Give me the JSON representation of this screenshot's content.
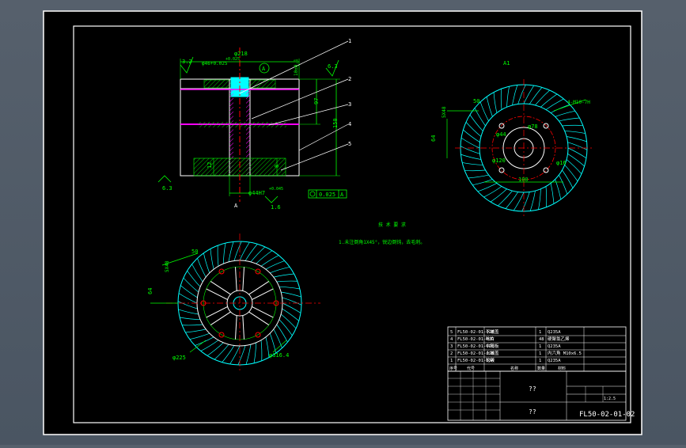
{
  "sheet": {
    "colors": {
      "background": "#000000",
      "frame": "#ffffff",
      "dimension": "#00ff00",
      "gear_teeth": "#00ffff",
      "center_line": "#ff0000",
      "hatch": "#ff00ff",
      "hidden": "#ffff00"
    }
  },
  "section_view": {
    "dims": {
      "top_dia": "φ218",
      "bore_tol": "φ46+0.025",
      "bore_zero": "0",
      "bore_sub": "+0.025",
      "roughness_top": "3.2",
      "roughness_right": "6.3",
      "roughness_bottom": "6.3",
      "datum_a": "A",
      "flatness": "10±0.1",
      "h97": "97",
      "h150": "150",
      "dim_12": "12",
      "dim_8": "8",
      "bottom_dia": "φ44H7",
      "bottom_sub": "+0.045",
      "r16": "1.6",
      "tolerance": "0.025",
      "tol_ref": "A",
      "view_label": "A"
    },
    "callouts": [
      "1",
      "2",
      "3",
      "4",
      "5"
    ]
  },
  "top_view": {
    "label": "A1",
    "dims": {
      "d50": "50",
      "d5x48": "5X48",
      "d64": "64",
      "holes": "4-M10-7H",
      "d100": "100",
      "d16": "φ16",
      "d44": "φ44",
      "d78": "φ78",
      "d120": "φ120"
    }
  },
  "bottom_view": {
    "dims": {
      "d50": "50",
      "d5x48": "5X48",
      "d64": "64",
      "d225": "φ225",
      "d3164": "φ316.4"
    }
  },
  "notes": {
    "title": "技 术 要 求",
    "line1": "1.未注倒角1X45°，锐边倒钝，去毛刺。"
  },
  "parts_list": {
    "rows": [
      {
        "no": "5",
        "code": "FL50-02-01-02E",
        "name": "下端盖",
        "qty": "1",
        "material": "Q235A"
      },
      {
        "no": "4",
        "code": "FL50-02-01-02D",
        "name": "叶片",
        "qty": "48",
        "material": "硬聚氯乙烯"
      },
      {
        "no": "3",
        "code": "FL50-02-01-02C",
        "name": "中隔板",
        "qty": "1",
        "material": "Q235A"
      },
      {
        "no": "2",
        "code": "FL50-02-01-02B",
        "name": "上端盖",
        "qty": "1",
        "material": "内六角 M10x6.5"
      },
      {
        "no": "1",
        "code": "FL50-02-01-02A",
        "name": "轮毂",
        "qty": "1",
        "material": "Q235A"
      }
    ],
    "header": {
      "no": "序号",
      "code": "代号",
      "name": "名称",
      "qty": "数量",
      "material": "材料"
    }
  },
  "title_block": {
    "name_placeholder": "??",
    "company_placeholder": "??",
    "scale": "1:2.5",
    "drawing_number": "FL50-02-01-02"
  }
}
